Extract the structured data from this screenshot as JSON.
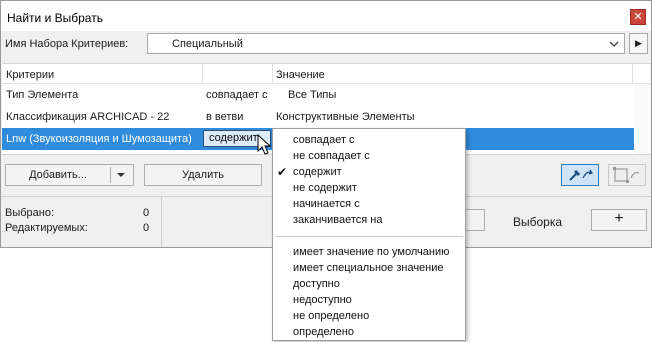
{
  "window": {
    "title": "Найти и Выбрать",
    "close_glyph": "✕"
  },
  "criteria_set": {
    "label": "Имя Набора Критериев:",
    "value": "Специальный",
    "side_button_glyph": "▶"
  },
  "grid": {
    "columns": [
      "Критерии",
      "",
      "Значение"
    ],
    "rows": [
      {
        "criterion": "Тип Элемента",
        "operator": "совпадает с",
        "value": "Все Типы"
      },
      {
        "criterion": "Классификация ARCHICAD - 22",
        "operator": "в ветви",
        "value": "Конструктивные Элементы"
      },
      {
        "criterion": "Lnw (Звукоизоляция и Шумозащита)",
        "operator": "содержит",
        "value": "",
        "selected": true
      }
    ]
  },
  "buttons": {
    "add": "Добавить...",
    "remove": "Удалить",
    "selection": "Выборка",
    "plus": "+"
  },
  "stats": {
    "selected_label": "Выбрано:",
    "selected_value": "0",
    "editable_label": "Редактируемых:",
    "editable_value": "0"
  },
  "operator_menu": {
    "checked_index": 2,
    "group1": [
      "совпадает с",
      "не совпадает с",
      "содержит",
      "не содержит",
      "начинается с",
      "заканчивается на"
    ],
    "group2": [
      "имеет значение по умолчанию",
      "имеет специальное значение",
      "доступно",
      "недоступно",
      "не определено",
      "определено"
    ],
    "check_glyph": "✔"
  },
  "colors": {
    "selection_blue": "#2f8bdc",
    "close_red": "#c9463d"
  }
}
